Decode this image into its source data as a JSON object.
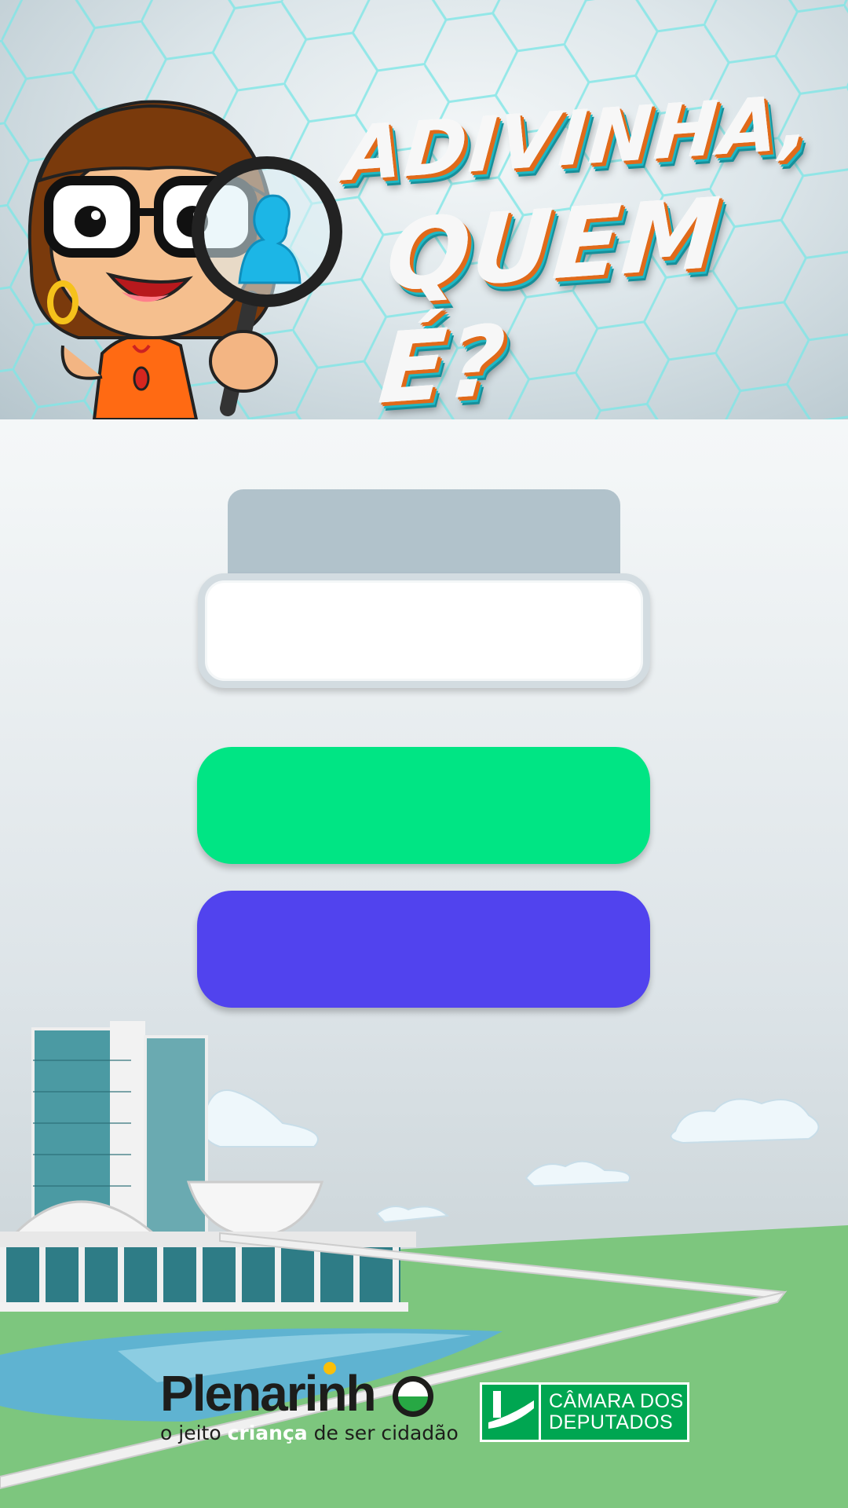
{
  "header": {
    "title_line1": "ADIVINHA,",
    "title_line2": "QUEM É?"
  },
  "form": {
    "name_label": "",
    "name_value": "",
    "name_placeholder": "",
    "primary_button_label": "",
    "secondary_button_label": ""
  },
  "footer": {
    "plenarinho_name": "Plenarinh",
    "plenarinho_tagline_start": "o jeito ",
    "plenarinho_tagline_highlight": "criança",
    "plenarinho_tagline_end": " de ser cidadão",
    "camara_line1": "CÂMARA DOS",
    "camara_line2": "DEPUTADOS"
  },
  "colors": {
    "primary_button": "#00e584",
    "secondary_button": "#5143ee",
    "label_tab": "#b1c2cb",
    "camara_green": "#00a651",
    "grass": "#7dc67e"
  }
}
